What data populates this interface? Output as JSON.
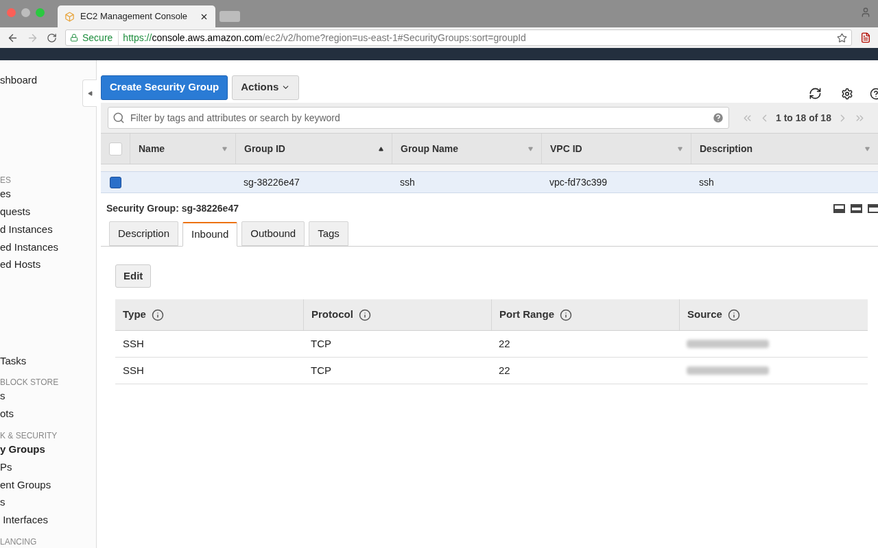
{
  "browser": {
    "tab_title": "EC2 Management Console",
    "secure_label": "Secure",
    "url_scheme": "https://",
    "url_host": "console.aws.amazon.com",
    "url_path": "/ec2/v2/home?region=us-east-1#SecurityGroups:sort=groupId"
  },
  "sidebar": {
    "items": [
      {
        "kind": "link",
        "label": "shboard",
        "selected": false
      },
      {
        "kind": "gap"
      },
      {
        "kind": "header",
        "label": "ES"
      },
      {
        "kind": "link",
        "label": "es",
        "selected": false
      },
      {
        "kind": "link",
        "label": "quests",
        "selected": false
      },
      {
        "kind": "link",
        "label": "d Instances",
        "selected": false
      },
      {
        "kind": "link",
        "label": "ed Instances",
        "selected": false
      },
      {
        "kind": "link",
        "label": "ed Hosts",
        "selected": false
      },
      {
        "kind": "gap"
      },
      {
        "kind": "link",
        "label": "Tasks",
        "selected": false
      },
      {
        "kind": "header",
        "label": "BLOCK STORE"
      },
      {
        "kind": "link",
        "label": "s",
        "selected": false
      },
      {
        "kind": "link",
        "label": "ots",
        "selected": false
      },
      {
        "kind": "header",
        "label": "K & SECURITY"
      },
      {
        "kind": "link",
        "label": "y Groups",
        "selected": true
      },
      {
        "kind": "link",
        "label": "Ps",
        "selected": false
      },
      {
        "kind": "link",
        "label": "ent Groups",
        "selected": false
      },
      {
        "kind": "link",
        "label": "s",
        "selected": false
      },
      {
        "kind": "link",
        "label": " Interfaces",
        "selected": false
      },
      {
        "kind": "header",
        "label": "LANCING"
      }
    ]
  },
  "toolbar": {
    "create_button": "Create Security Group",
    "actions_button": "Actions"
  },
  "search": {
    "placeholder": "Filter by tags and attributes or search by keyword"
  },
  "pagination": {
    "label": "1 to 18 of 18"
  },
  "table": {
    "select_all_checked": false,
    "columns": [
      {
        "label": "Name",
        "sorted": false
      },
      {
        "label": "Group ID",
        "sorted": true
      },
      {
        "label": "Group Name",
        "sorted": false
      },
      {
        "label": "VPC ID",
        "sorted": false
      },
      {
        "label": "Description",
        "sorted": false
      }
    ],
    "rows": [
      {
        "selected": true,
        "cells": [
          "",
          "sg-38226e47",
          "ssh",
          "vpc-fd73c399",
          "ssh"
        ]
      }
    ]
  },
  "details": {
    "title": "Security Group: sg-38226e47",
    "tabs": [
      {
        "label": "Description",
        "selected": false
      },
      {
        "label": "Inbound",
        "selected": true
      },
      {
        "label": "Outbound",
        "selected": false
      },
      {
        "label": "Tags",
        "selected": false
      }
    ],
    "edit_button": "Edit",
    "rules": {
      "columns": [
        "Type",
        "Protocol",
        "Port Range",
        "Source"
      ],
      "rows": [
        [
          "SSH",
          "TCP",
          "22"
        ],
        [
          "SSH",
          "TCP",
          "22"
        ]
      ]
    }
  }
}
